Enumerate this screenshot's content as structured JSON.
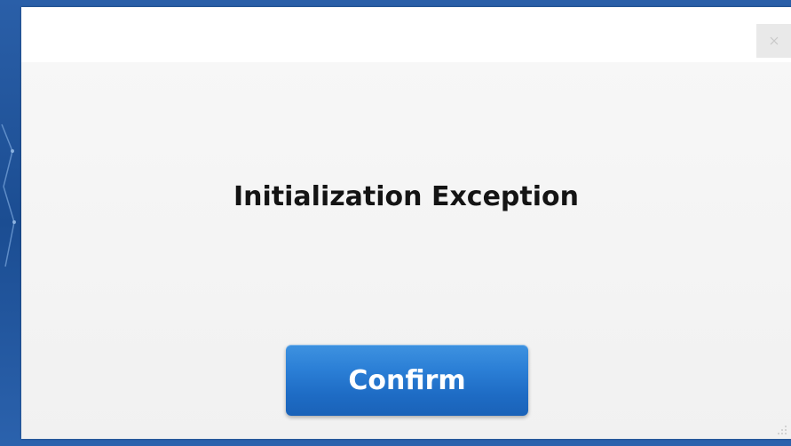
{
  "dialog": {
    "message": "Initialization Exception",
    "confirm_label": "Confirm",
    "close_icon": "close-icon"
  },
  "colors": {
    "backdrop": "#1c4f93",
    "dialog_bg": "#f1f1f1",
    "button_top": "#3e92e0",
    "button_bottom": "#1a62b8",
    "text": "#141414"
  }
}
